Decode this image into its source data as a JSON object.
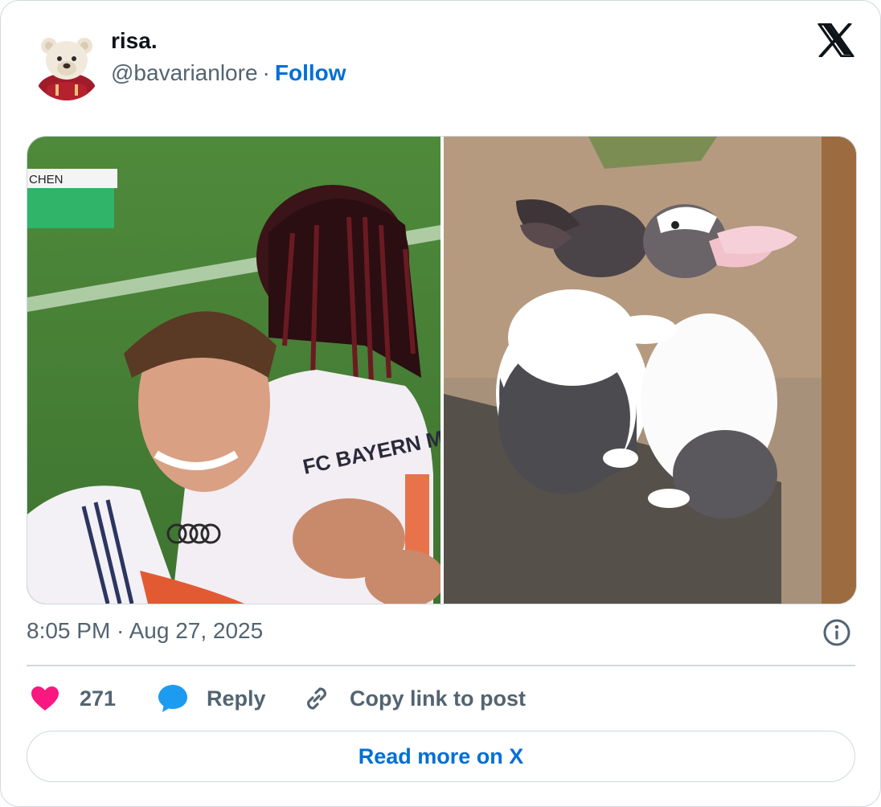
{
  "author": {
    "name": "risa.",
    "handle": "@bavarianlore",
    "separator": "·",
    "follow_label": "Follow",
    "avatar_icon": "teddy-bear-avatar"
  },
  "brand": {
    "logo_icon": "x-logo-icon"
  },
  "media": {
    "left_image": "football-players-hugging",
    "left_overlay_text": "CHEN",
    "left_jersey_text": "FC BAYERN MÜ",
    "right_image": "two-rabbits-hugging"
  },
  "timestamp": {
    "text": "8:05 PM · Aug 27, 2025",
    "info_icon": "info-icon"
  },
  "actions": {
    "like_count": "271",
    "reply_label": "Reply",
    "copy_label": "Copy link to post"
  },
  "read_more_label": "Read more on X",
  "colors": {
    "text_primary": "#0f1419",
    "text_secondary": "#536471",
    "link_blue": "#006fd6",
    "like_pink": "#f91880",
    "reply_blue": "#1d9bf0",
    "border": "#cfd9de"
  }
}
